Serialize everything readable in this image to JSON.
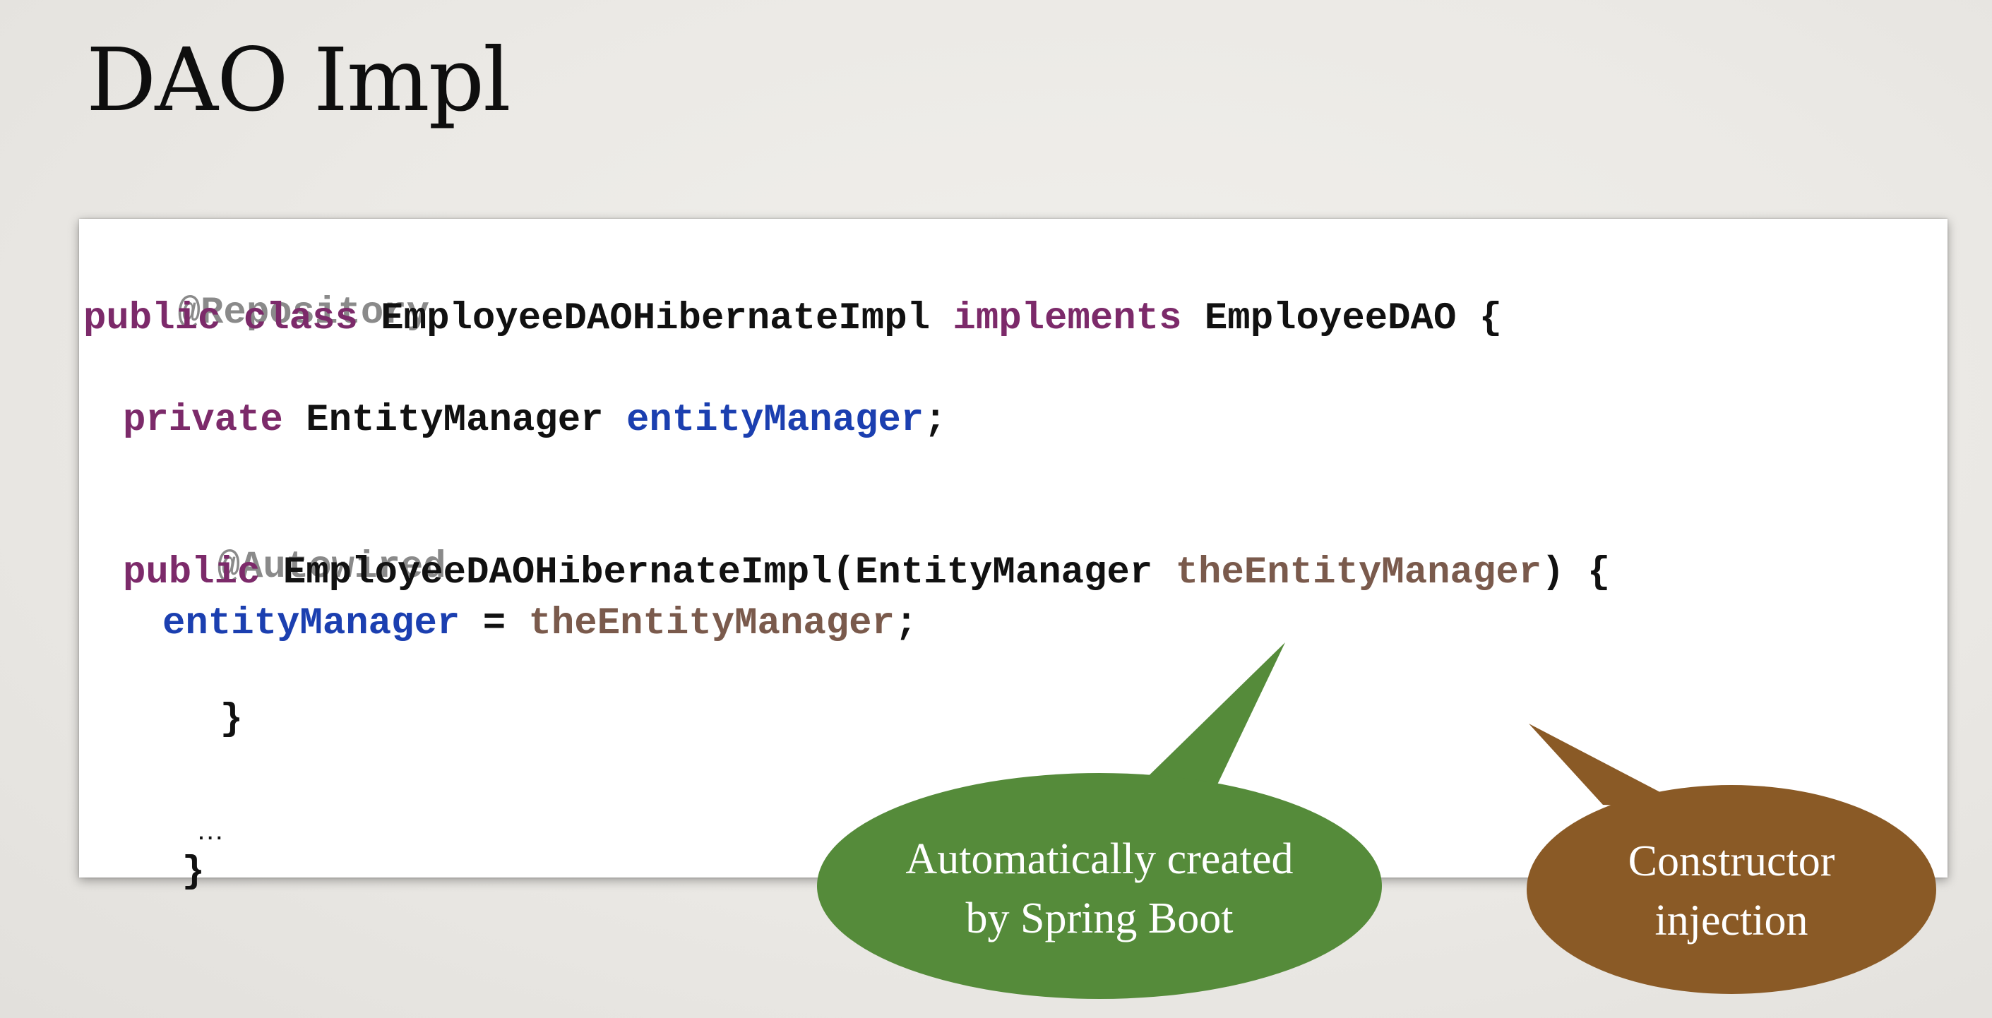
{
  "slide": {
    "title": "DAO Impl"
  },
  "code": {
    "line1_annotation": "@Repository",
    "line2_kw1": "public",
    "line2_kw2": "class",
    "line2_classname": "EmployeeDAOHibernateImpl",
    "line2_kw3": "implements",
    "line2_interface": "EmployeeDAO {",
    "line3_kw": "private",
    "line3_type": "EntityManager",
    "line3_field": "entityManager",
    "line3_end": ";",
    "line4_annotation": "@Autowired",
    "line5_kw": "public",
    "line5_ctor": "EmployeeDAOHibernateImpl(EntityManager",
    "line5_param": "theEntityManager",
    "line5_end": ") {",
    "line6_field": "entityManager",
    "line6_op": "=",
    "line6_param": "theEntityManager",
    "line6_end": ";",
    "line7_brace": "}",
    "line8_ellipsis": "…",
    "line9_brace": "}"
  },
  "callouts": {
    "auto_created_line1": "Automatically created",
    "auto_created_line2": "by Spring Boot",
    "auto_created_color": "#558b3a",
    "constructor_line1": "Constructor",
    "constructor_line2": "injection",
    "constructor_color": "#8a5a26"
  },
  "colors": {
    "annotation": "#8a8a8a",
    "keyword": "#7c2a6a",
    "field": "#1b3fb0",
    "param": "#7a5a4c"
  }
}
